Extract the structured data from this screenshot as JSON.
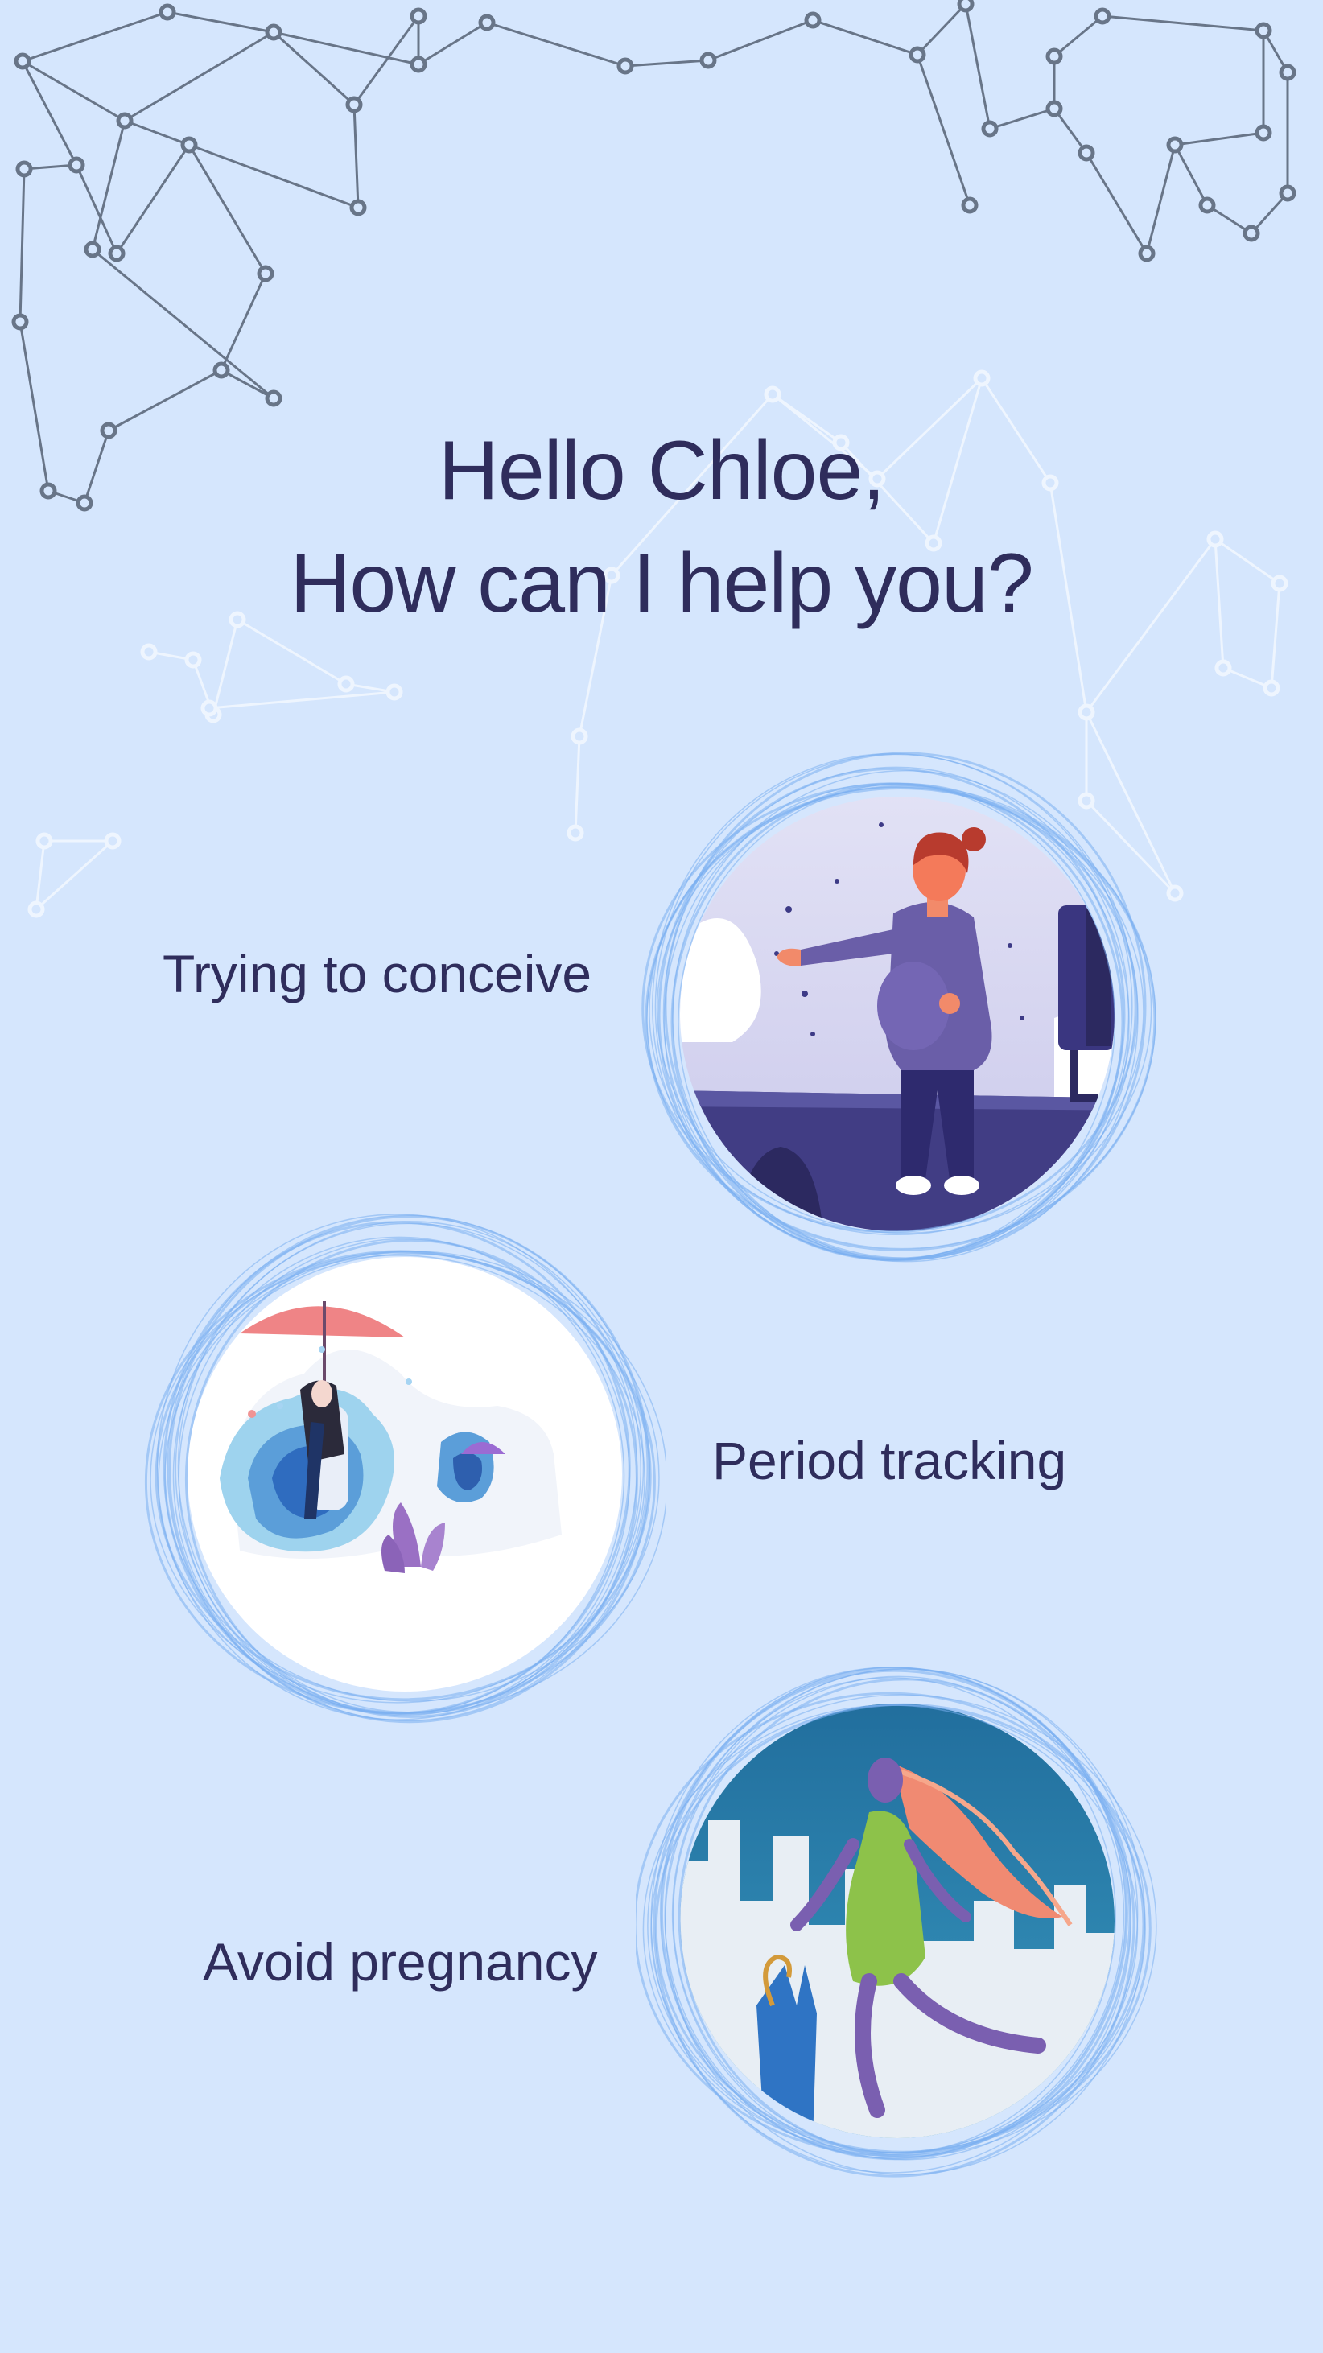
{
  "greeting": {
    "line1": "Hello Chloe,",
    "line2": "How can I help you?"
  },
  "options": [
    {
      "label": "Trying to conceive",
      "illustration": "pregnant-woman-illustration"
    },
    {
      "label": "Period tracking",
      "illustration": "woman-with-umbrella-illustration"
    },
    {
      "label": "Avoid pregnancy",
      "illustration": "woman-in-wind-illustration"
    }
  ],
  "colors": {
    "background": "#d5e6fd",
    "text": "#2f2d5c",
    "ring": "#7aaef0",
    "network_dark": "#4d5a6e",
    "network_light": "#f4f8ff"
  }
}
